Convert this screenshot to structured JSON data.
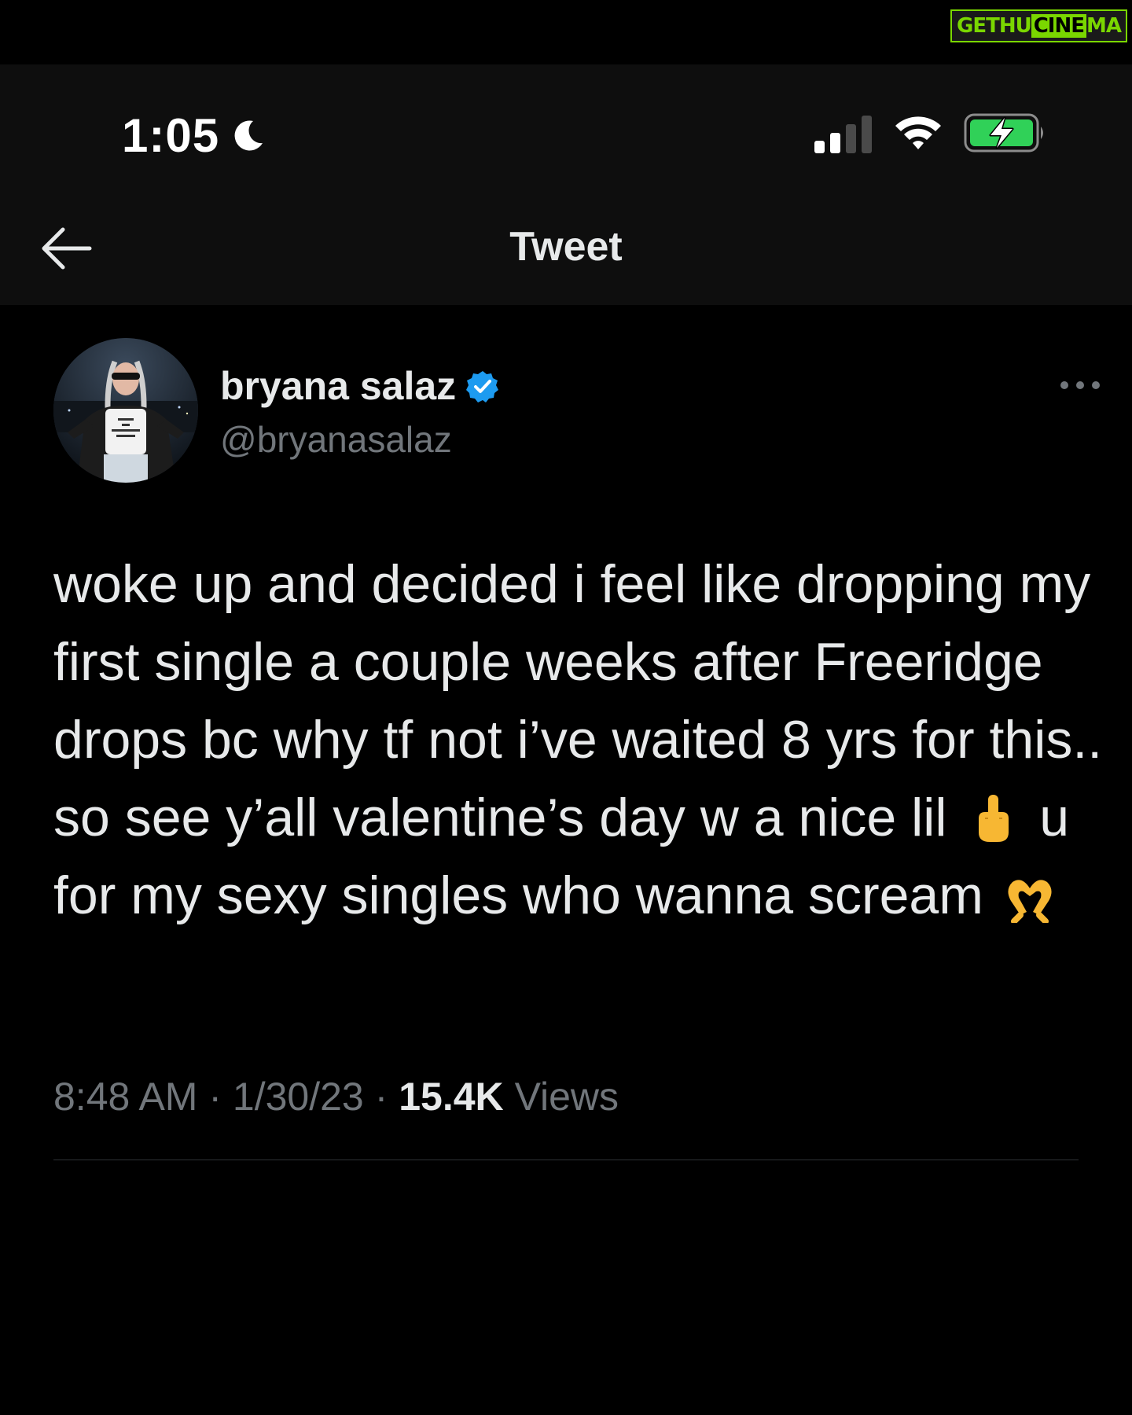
{
  "watermark": {
    "part1": "GETHU",
    "part2": "CINE",
    "part3": "MA"
  },
  "status_bar": {
    "time": "1:05",
    "icons": [
      "moon-icon",
      "cellular-signal-icon",
      "wifi-icon",
      "battery-charging-icon"
    ],
    "signal_bars_active": 2,
    "signal_bars_total": 4
  },
  "nav": {
    "back_icon": "back-arrow-icon",
    "title": "Tweet"
  },
  "author": {
    "display_name": "bryana salaz",
    "handle": "@bryanasalaz",
    "verified": true,
    "avatar_shirt_text": [
      "GIRLS",
      "DO",
      "EVERYTHING",
      "BETTER"
    ]
  },
  "tweet": {
    "text_before_emoji1": "woke up and decided i feel like dropping my first single a couple weeks after Freeridge drops bc why tf not i’ve waited 8 yrs for this..  so see y’all valentine’s day w a nice lil",
    "emoji1": "middle-finger-emoji",
    "text_between": "u for my sexy singles who wanna scream",
    "emoji2": "heart-hands-emoji"
  },
  "meta": {
    "time": "8:48 AM",
    "date": "1/30/23",
    "sep": "·",
    "views_count": "15.4K",
    "views_label": "Views"
  },
  "colors": {
    "background": "#000000",
    "header_background": "#0e0e0e",
    "primary_text": "#e7e9ea",
    "secondary_text": "#71767b",
    "verified_blue": "#1d9bf0",
    "battery_green": "#30d158"
  }
}
